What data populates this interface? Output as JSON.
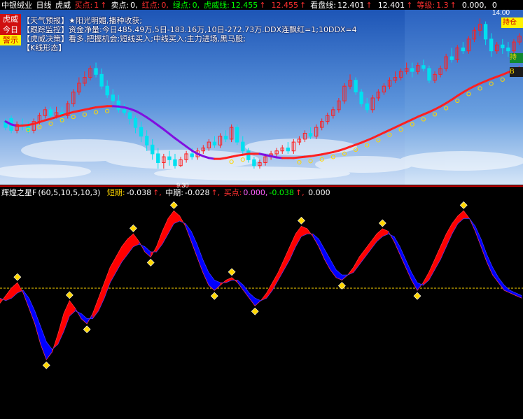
{
  "top_header": {
    "stock_name": "中银绒业",
    "period": "日线",
    "indicator": "虎威",
    "items": [
      {
        "label": "买点:",
        "value": "1",
        "arrow": "↑",
        "color": "#ff3030"
      },
      {
        "label": "卖点:",
        "value": "0,",
        "arrow": "",
        "color": "#ffffff"
      },
      {
        "label": "红点:",
        "value": "0,",
        "arrow": "",
        "color": "#ff3030"
      },
      {
        "label": "绿点:",
        "value": "0,",
        "arrow": "",
        "color": "#00ff00"
      },
      {
        "label": "虎威线:",
        "value": "12.455",
        "arrow": "↑",
        "color": "#00ff00"
      },
      {
        "label": "",
        "value": "12.455",
        "arrow": "↑",
        "color": "#ff3030"
      },
      {
        "label": "看盘线:",
        "value": "12.401",
        "arrow": "↑",
        "color": "#ffffff"
      },
      {
        "label": "",
        "value": "12.401",
        "arrow": "↑",
        "color": "#ffffff"
      },
      {
        "label": "等级:",
        "value": "1.3",
        "arrow": "↑",
        "color": "#ff3030"
      },
      {
        "label": "",
        "value": "0.000,",
        "arrow": "",
        "color": "#ffffff"
      },
      {
        "label": "",
        "value": "0",
        "arrow": "",
        "color": "#ffffff"
      }
    ]
  },
  "side_tags": [
    {
      "text": "虎威",
      "bg": "#d01010",
      "fg": "#ffffff"
    },
    {
      "text": "今日",
      "bg": "#d01010",
      "fg": "#ffffff"
    },
    {
      "text": "警示",
      "bg": "#fff200",
      "fg": "#d00000"
    }
  ],
  "info_lines": [
    "【天气预报】★阳光明媚,播种收获;",
    "【跟踪监控】资金净量:今日485.49万,5日-183.16万,10日-272.73万.DDX连飘红=1;10DDX=4",
    "【虎威决策】看多,把握机会;短线买入;中线买入;主力进场,黑马股;",
    "【K线形态】"
  ],
  "hold_tag": "持仓",
  "right_tags": [
    "持",
    "B"
  ],
  "price_label": "14.00",
  "low_label": "9.30",
  "sub_header": {
    "name": "辉煌之星F",
    "params": "(60,5,10,5,10,3)",
    "short_label": "短期:",
    "short_value": "-0.038",
    "mid_label": "中期:",
    "mid_value": "-0.028",
    "buy_label": "买点:",
    "buy_value1": "0.000,",
    "buy_value2": "-0.038",
    "last_value": "0.000"
  },
  "colors": {
    "up": "#ff2020",
    "down": "#00e0f0",
    "wave_up": "#ff0000",
    "wave_down": "#0000ff",
    "avg_up": "#ff2020",
    "avg_down": "#8010e0",
    "zero_line": "#ffd700",
    "sky_top": "#1d55b6",
    "sky_bottom": "#c8dcf4",
    "signal": "#ffd700"
  },
  "chart_data": [
    {
      "type": "candlestick",
      "title": "中银绒业 日线",
      "ylim": [
        8.8,
        14.6
      ],
      "avg_line": [
        10.9,
        10.8,
        10.75,
        10.76,
        10.78,
        10.82,
        10.88,
        10.94,
        10.99,
        11.05,
        11.11,
        11.17,
        11.22,
        11.26,
        11.3,
        11.34,
        11.38,
        11.4,
        11.42,
        11.42,
        11.41,
        11.38,
        11.33,
        11.26,
        11.16,
        11.04,
        10.91,
        10.77,
        10.63,
        10.48,
        10.33,
        10.19,
        10.05,
        9.91,
        9.8,
        9.72,
        9.66,
        9.63,
        9.63,
        9.66,
        9.7,
        9.74,
        9.77,
        9.8,
        9.8,
        9.8,
        9.76,
        9.72,
        9.68,
        9.66,
        9.66,
        9.66,
        9.68,
        9.7,
        9.72,
        9.75,
        9.78,
        9.82,
        9.86,
        9.91,
        9.97,
        10.04,
        10.11,
        10.18,
        10.26,
        10.34,
        10.43,
        10.52,
        10.61,
        10.7,
        10.79,
        10.88,
        10.97,
        11.06,
        11.14,
        11.22,
        11.31,
        11.41,
        11.52,
        11.64,
        11.77,
        11.89,
        12.0,
        12.1,
        12.19,
        12.27,
        12.35,
        12.42,
        12.49,
        12.57,
        12.65,
        12.73
      ],
      "candles": [
        [
          10.9,
          11.0,
          10.7,
          10.6
        ],
        [
          11.0,
          11.1,
          10.6,
          10.5
        ],
        [
          10.6,
          10.9,
          10.8,
          10.5
        ],
        [
          10.8,
          11.0,
          10.75,
          10.6
        ],
        [
          10.75,
          10.9,
          10.6,
          10.5
        ],
        [
          10.6,
          11.0,
          10.9,
          10.5
        ],
        [
          10.9,
          11.2,
          11.1,
          10.8
        ],
        [
          11.1,
          11.4,
          11.3,
          11.0
        ],
        [
          11.3,
          11.4,
          11.1,
          11.0
        ],
        [
          11.1,
          11.4,
          11.2,
          11.0
        ],
        [
          11.2,
          11.4,
          11.1,
          10.9
        ],
        [
          11.1,
          11.6,
          11.5,
          11.0
        ],
        [
          11.5,
          12.0,
          11.9,
          11.4
        ],
        [
          11.9,
          12.4,
          12.2,
          11.8
        ],
        [
          12.2,
          12.6,
          12.4,
          12.1
        ],
        [
          12.4,
          12.8,
          12.7,
          12.3
        ],
        [
          12.7,
          12.9,
          12.5,
          12.4
        ],
        [
          12.5,
          12.7,
          12.1,
          12.0
        ],
        [
          12.1,
          12.3,
          11.8,
          11.7
        ],
        [
          11.8,
          12.0,
          11.6,
          11.5
        ],
        [
          11.6,
          11.8,
          11.3,
          11.2
        ],
        [
          11.3,
          11.5,
          11.2,
          11.1
        ],
        [
          11.2,
          11.4,
          11.0,
          10.8
        ],
        [
          11.0,
          11.1,
          10.7,
          10.5
        ],
        [
          10.7,
          10.9,
          10.4,
          10.2
        ],
        [
          10.4,
          10.6,
          10.1,
          9.9
        ],
        [
          10.1,
          10.3,
          9.8,
          9.6
        ],
        [
          9.8,
          10.0,
          9.5,
          9.3
        ],
        [
          9.5,
          9.8,
          9.7,
          9.3
        ],
        [
          9.7,
          9.9,
          9.6,
          9.4
        ],
        [
          9.6,
          9.8,
          9.4,
          9.3
        ],
        [
          9.4,
          9.7,
          9.6,
          9.35
        ],
        [
          9.6,
          9.9,
          9.8,
          9.5
        ],
        [
          9.8,
          10.0,
          9.7,
          9.6
        ],
        [
          9.7,
          10.0,
          9.9,
          9.6
        ],
        [
          9.9,
          10.1,
          10.0,
          9.8
        ],
        [
          10.0,
          10.3,
          10.2,
          9.9
        ],
        [
          10.2,
          10.4,
          10.1,
          10.0
        ],
        [
          10.1,
          10.5,
          10.4,
          10.0
        ],
        [
          10.4,
          10.6,
          10.3,
          10.2
        ],
        [
          10.3,
          10.8,
          10.7,
          10.2
        ],
        [
          10.7,
          10.8,
          10.2,
          10.1
        ],
        [
          10.2,
          10.4,
          9.9,
          9.8
        ],
        [
          9.9,
          10.0,
          9.6,
          9.5
        ],
        [
          9.6,
          9.7,
          9.4,
          9.3
        ],
        [
          9.4,
          9.6,
          9.5,
          9.3
        ],
        [
          9.5,
          9.8,
          9.7,
          9.4
        ],
        [
          9.7,
          9.9,
          9.8,
          9.6
        ],
        [
          9.8,
          10.0,
          9.9,
          9.7
        ],
        [
          9.9,
          10.1,
          10.0,
          9.8
        ],
        [
          10.0,
          10.2,
          9.9,
          9.8
        ],
        [
          9.9,
          10.3,
          10.2,
          9.8
        ],
        [
          10.2,
          10.4,
          10.3,
          10.1
        ],
        [
          10.3,
          10.6,
          10.5,
          10.2
        ],
        [
          10.5,
          10.7,
          10.4,
          10.3
        ],
        [
          10.4,
          10.8,
          10.7,
          10.3
        ],
        [
          10.7,
          11.0,
          10.9,
          10.6
        ],
        [
          10.9,
          11.2,
          11.1,
          10.8
        ],
        [
          11.1,
          11.4,
          11.3,
          11.0
        ],
        [
          11.3,
          11.7,
          11.6,
          11.2
        ],
        [
          11.6,
          12.2,
          12.1,
          11.5
        ],
        [
          12.1,
          12.5,
          12.3,
          12.0
        ],
        [
          12.3,
          12.4,
          11.9,
          11.8
        ],
        [
          11.9,
          12.0,
          11.5,
          11.4
        ],
        [
          11.5,
          11.7,
          11.3,
          11.2
        ],
        [
          11.3,
          11.8,
          11.7,
          11.2
        ],
        [
          11.7,
          12.0,
          11.9,
          11.6
        ],
        [
          11.9,
          12.2,
          12.1,
          11.8
        ],
        [
          12.1,
          12.4,
          12.3,
          12.0
        ],
        [
          12.3,
          12.6,
          12.4,
          12.2
        ],
        [
          12.4,
          12.7,
          12.6,
          12.3
        ],
        [
          12.6,
          12.9,
          12.7,
          12.5
        ],
        [
          12.7,
          12.9,
          12.6,
          12.4
        ],
        [
          12.6,
          12.9,
          12.8,
          12.5
        ],
        [
          12.8,
          13.0,
          12.7,
          12.6
        ],
        [
          12.7,
          12.8,
          12.3,
          12.2
        ],
        [
          12.3,
          12.6,
          12.5,
          12.2
        ],
        [
          12.5,
          12.8,
          12.7,
          12.4
        ],
        [
          12.7,
          13.2,
          13.1,
          12.6
        ],
        [
          13.1,
          13.4,
          13.0,
          12.9
        ],
        [
          13.0,
          13.5,
          13.4,
          12.9
        ],
        [
          13.4,
          13.6,
          13.3,
          13.2
        ],
        [
          13.3,
          13.8,
          13.7,
          13.2
        ],
        [
          13.7,
          14.1,
          14.0,
          13.6
        ],
        [
          14.0,
          14.4,
          14.2,
          13.8
        ],
        [
          14.2,
          14.3,
          13.7,
          13.5
        ],
        [
          13.7,
          13.9,
          13.3,
          13.1
        ],
        [
          13.3,
          13.6,
          13.5,
          13.2
        ],
        [
          13.5,
          13.7,
          13.4,
          13.2
        ],
        [
          13.4,
          13.6,
          13.3,
          13.1
        ],
        [
          13.3,
          13.7,
          13.6,
          13.2
        ],
        [
          13.6,
          13.9,
          13.8,
          13.5
        ]
      ]
    },
    {
      "type": "area",
      "title": "辉煌之星F",
      "ylim": [
        -0.5,
        0.35
      ],
      "series": [
        {
          "name": "短期",
          "values": [
            -0.06,
            -0.03,
            0.0,
            0.02,
            -0.02,
            -0.08,
            -0.14,
            -0.22,
            -0.28,
            -0.25,
            -0.18,
            -0.1,
            -0.05,
            -0.08,
            -0.12,
            -0.14,
            -0.1,
            -0.04,
            0.02,
            0.08,
            0.12,
            0.16,
            0.19,
            0.21,
            0.18,
            0.14,
            0.12,
            0.16,
            0.22,
            0.27,
            0.3,
            0.28,
            0.24,
            0.18,
            0.12,
            0.06,
            0.01,
            -0.01,
            0.01,
            0.03,
            0.04,
            0.02,
            -0.01,
            -0.04,
            -0.07,
            -0.05,
            -0.02,
            0.02,
            0.06,
            0.11,
            0.16,
            0.21,
            0.24,
            0.23,
            0.2,
            0.16,
            0.11,
            0.07,
            0.04,
            0.03,
            0.05,
            0.08,
            0.12,
            0.15,
            0.18,
            0.21,
            0.23,
            0.22,
            0.18,
            0.13,
            0.08,
            0.03,
            -0.01,
            0.02,
            0.06,
            0.11,
            0.16,
            0.21,
            0.25,
            0.28,
            0.3,
            0.27,
            0.22,
            0.16,
            0.1,
            0.05,
            0.02,
            -0.01,
            -0.02,
            -0.03,
            -0.04
          ]
        },
        {
          "name": "中期",
          "values": [
            -0.04,
            -0.05,
            -0.04,
            -0.02,
            -0.01,
            -0.04,
            -0.09,
            -0.15,
            -0.21,
            -0.24,
            -0.22,
            -0.17,
            -0.11,
            -0.09,
            -0.1,
            -0.12,
            -0.12,
            -0.09,
            -0.04,
            0.02,
            0.06,
            0.1,
            0.13,
            0.16,
            0.17,
            0.16,
            0.14,
            0.14,
            0.17,
            0.21,
            0.25,
            0.26,
            0.25,
            0.22,
            0.17,
            0.11,
            0.06,
            0.03,
            0.02,
            0.02,
            0.03,
            0.03,
            0.01,
            -0.02,
            -0.04,
            -0.05,
            -0.04,
            -0.01,
            0.03,
            0.07,
            0.11,
            0.16,
            0.2,
            0.21,
            0.21,
            0.19,
            0.15,
            0.11,
            0.07,
            0.05,
            0.05,
            0.06,
            0.09,
            0.12,
            0.15,
            0.18,
            0.2,
            0.21,
            0.2,
            0.16,
            0.11,
            0.06,
            0.02,
            0.01,
            0.03,
            0.07,
            0.11,
            0.16,
            0.21,
            0.25,
            0.27,
            0.27,
            0.24,
            0.19,
            0.13,
            0.08,
            0.04,
            0.01,
            -0.01,
            -0.02,
            -0.03
          ]
        }
      ],
      "zero_line": 0
    }
  ]
}
